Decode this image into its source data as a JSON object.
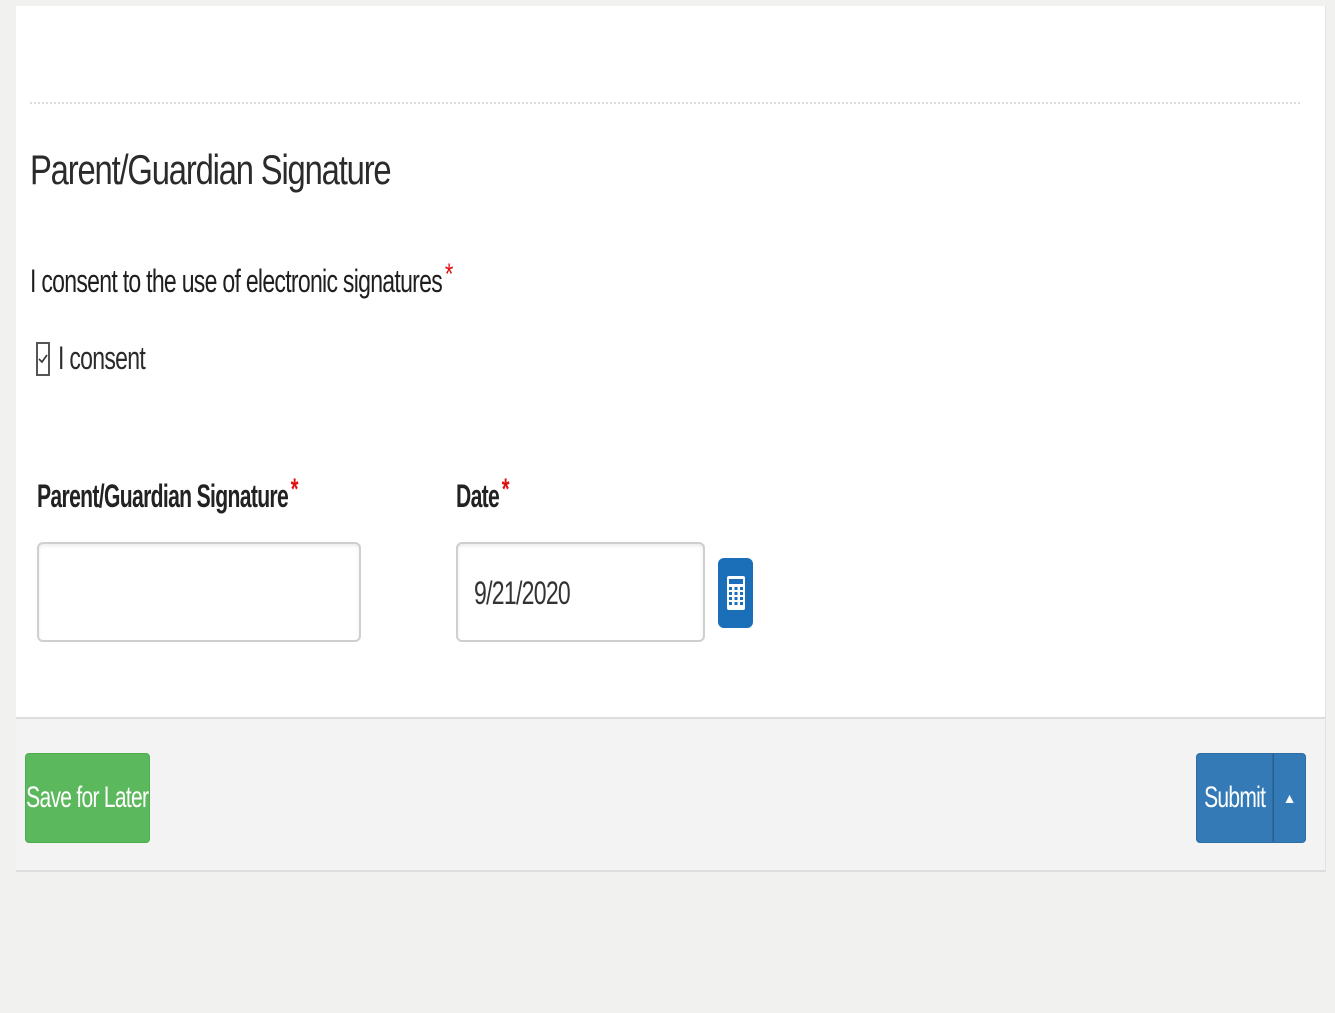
{
  "section": {
    "title": "Parent/Guardian Signature"
  },
  "consent": {
    "question": "I consent to the use of electronic signatures",
    "required_mark": "*",
    "checkbox_label": "I consent",
    "checked": true
  },
  "fields": {
    "signature": {
      "label": "Parent/Guardian Signature",
      "required_mark": "*",
      "value": ""
    },
    "date": {
      "label": "Date",
      "required_mark": "*",
      "value": "9/21/2020",
      "picker_icon": "calendar-icon"
    }
  },
  "footer": {
    "save_label": "Save for Later",
    "submit_label": "Submit",
    "toggle_icon": "caret-up-icon"
  },
  "colors": {
    "required": "#e01010",
    "save_button": "#5cb85c",
    "submit_button": "#337ab7",
    "calendar_button": "#1a6fb8"
  }
}
